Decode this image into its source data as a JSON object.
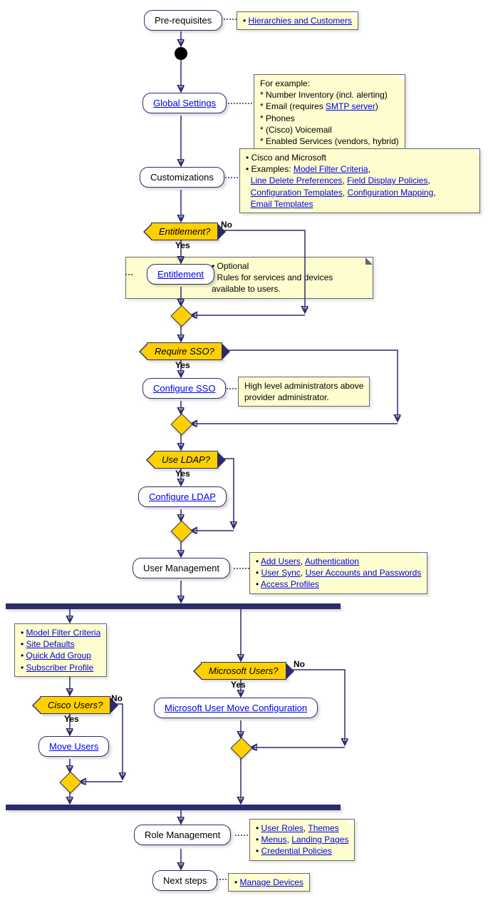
{
  "chart_data": {
    "type": "activity-diagram",
    "title": "",
    "nodes": {
      "prereq": {
        "label": "Pre-requisites",
        "link": false
      },
      "global": {
        "label": "Global Settings",
        "link": true
      },
      "custom": {
        "label": "Customizations",
        "link": false
      },
      "entitlement_q": {
        "label": "Entitlement?",
        "type": "decision"
      },
      "entitlement": {
        "label": "Entitlement",
        "link": true
      },
      "sso_q": {
        "label": "Require SSO?",
        "type": "decision"
      },
      "sso": {
        "label": "Configure SSO",
        "link": true
      },
      "ldap_q": {
        "label": "Use LDAP?",
        "type": "decision"
      },
      "ldap": {
        "label": "Configure LDAP",
        "link": true
      },
      "userman": {
        "label": "User Management",
        "link": false
      },
      "cisco_q": {
        "label": "Cisco Users?",
        "type": "decision"
      },
      "move": {
        "label": "Move Users",
        "link": true
      },
      "ms_q": {
        "label": "Microsoft Users?",
        "type": "decision"
      },
      "msmove": {
        "label": "Microsoft User Move Configuration",
        "link": true
      },
      "roleman": {
        "label": "Role Management",
        "link": false
      },
      "next": {
        "label": "Next steps",
        "link": false
      }
    },
    "labels": {
      "yes": "Yes",
      "no": "No"
    },
    "notes": {
      "prereq_note": {
        "bullet": "• ",
        "link1": "Hierarchies and Customers"
      },
      "global_note": {
        "intro": "For example:",
        "line1_a": "  * Number Inventory (incl. alerting)",
        "line2_a": "  * Email (requires ",
        "line2_link": "SMTP server",
        "line2_b": ")",
        "line3": "  * Phones",
        "line4": "  * (Cisco) Voicemail",
        "line5": "  * Enabled Services (vendors, hybrid)"
      },
      "custom_note": {
        "l1": "• Cisco and Microsoft",
        "l2a": "• Examples: ",
        "l2link1": "Model Filter Criteria",
        "comma": ",",
        "l3link1": "Line Delete Preferences",
        "l3link2": "Field Display Policies",
        "l4link1": "Configuration Templates",
        "l4link2": "Configuration Mapping",
        "l5link1": "Email Templates"
      },
      "ent_note": {
        "l1": "• Optional",
        "l2": "• Rules for services and devices",
        "l3": "  available to users."
      },
      "sso_note": {
        "l1": "High level administrators above",
        "l2": "provider administrator."
      },
      "userman_note": {
        "b1": "• ",
        "u1l1": "Add Users",
        "u1c": ", ",
        "u1l2": "Authentication",
        "b2": "• ",
        "u2l1": "User Sync",
        "u2c": ", ",
        "u2l2": "User Accounts and Passwords",
        "b3": "• ",
        "u3l1": "Access Profiles"
      },
      "cisco_note": {
        "b1": "• ",
        "c1": "Model Filter Criteria",
        "b2": "• ",
        "c2": "Site Defaults",
        "b3": "• ",
        "c3": "Quick Add Group",
        "b4": "• ",
        "c4": "Subscriber Profile"
      },
      "role_note": {
        "b1": "• ",
        "r1l1": "User Roles",
        "r1c": ", ",
        "r1l2": "Themes",
        "b2": "• ",
        "r2l1": "Menus",
        "r2c": ", ",
        "r2l2": "Landing Pages",
        "b3": "• ",
        "r3l1": "Credential Policies"
      },
      "next_note": {
        "b": "• ",
        "link": "Manage Devices"
      }
    }
  }
}
